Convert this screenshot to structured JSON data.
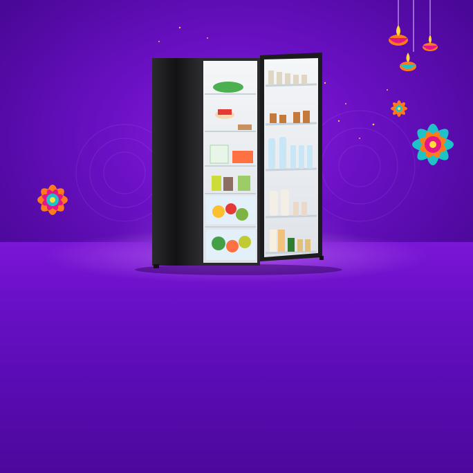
{
  "scene": {
    "description_colors": {
      "background": "#6a10c4",
      "floor": "#5a0cb4",
      "fridge_body": "#1c1c1e",
      "accent_orange": "#ff7a1a",
      "accent_teal": "#1fc3c7",
      "accent_magenta": "#e0168a"
    },
    "icons": [
      "diya-lamp-icon",
      "rangoli-flower-icon",
      "fridge-icon"
    ]
  }
}
